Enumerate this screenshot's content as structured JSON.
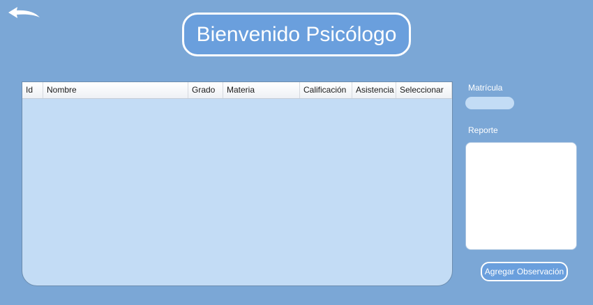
{
  "header": {
    "back_icon": "back-arrow-icon",
    "title": "Bienvenido Psicólogo"
  },
  "grid": {
    "columns": [
      "Id",
      "Nombre",
      "Grado",
      "Materia",
      "Calificación",
      "Asistencia",
      "Seleccionar"
    ],
    "rows": []
  },
  "form": {
    "matricula_label": "Matrícula",
    "matricula_value": "",
    "reporte_label": "Reporte",
    "reporte_value": "",
    "submit_label": "Agregar Observación"
  },
  "colors": {
    "background": "#7ba7d6",
    "accent": "#6a9fdd",
    "grid_body": "#c3dcf5"
  }
}
